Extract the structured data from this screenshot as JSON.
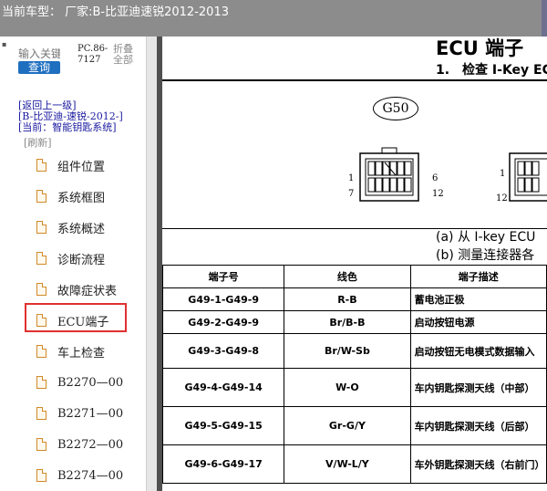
{
  "header": {
    "title": "当前车型： 厂家:B-比亚迪速锐2012-2013"
  },
  "sidebar": {
    "search": {
      "placeholder": "输入关键",
      "button": "查询"
    },
    "code": "PC.86-\n7127",
    "collapse_all": "折叠全部",
    "breadcrumb": {
      "back": "[返回上一级]",
      "model": "[B-比亚迪-速锐-2012-]",
      "current": "[当前：智能钥匙系统]"
    },
    "refresh": "[刷新]",
    "items": [
      {
        "label": "组件位置"
      },
      {
        "label": "系统框图"
      },
      {
        "label": "系统概述"
      },
      {
        "label": "诊断流程"
      },
      {
        "label": "故障症状表"
      },
      {
        "label": "ECU端子"
      },
      {
        "label": "车上检查"
      },
      {
        "label": "B2270—00"
      },
      {
        "label": "B2271—00"
      },
      {
        "label": "B2272—00"
      },
      {
        "label": "B2274—00"
      }
    ]
  },
  "document": {
    "title": "ECU 端子",
    "subtitle": "1.　检查 I-Key EC",
    "connector_label": "G50",
    "connector_a_pins": {
      "top_left": "1",
      "bottom_left": "7",
      "top_right": "6",
      "bottom_right": "12"
    },
    "connector_b_pins": {
      "top_left": "1",
      "bottom_left": "12"
    },
    "caption_a": "(a)  从 I-key ECU",
    "caption_b": "(b)  测量连接器各",
    "table": {
      "headers": [
        "端子号",
        "线色",
        "端子描述"
      ],
      "rows": [
        {
          "terminal": "G49-1-G49-9",
          "color": "R-B",
          "desc": "蓄电池正极"
        },
        {
          "terminal": "G49-2-G49-9",
          "color": "Br/B-B",
          "desc": "启动按钮电源"
        },
        {
          "terminal": "G49-3-G49-8",
          "color": "Br/W-Sb",
          "desc": "启动按钮无电模式数据输入"
        },
        {
          "terminal": "G49-4-G49-14",
          "color": "W-O",
          "desc": "车内钥匙探测天线（中部）"
        },
        {
          "terminal": "G49-5-G49-15",
          "color": "Gr-G/Y",
          "desc": "车内钥匙探测天线（后部）"
        },
        {
          "terminal": "G49-6-G49-17",
          "color": "V/W-L/Y",
          "desc": "车外钥匙探测天线（右前门）"
        }
      ]
    }
  }
}
